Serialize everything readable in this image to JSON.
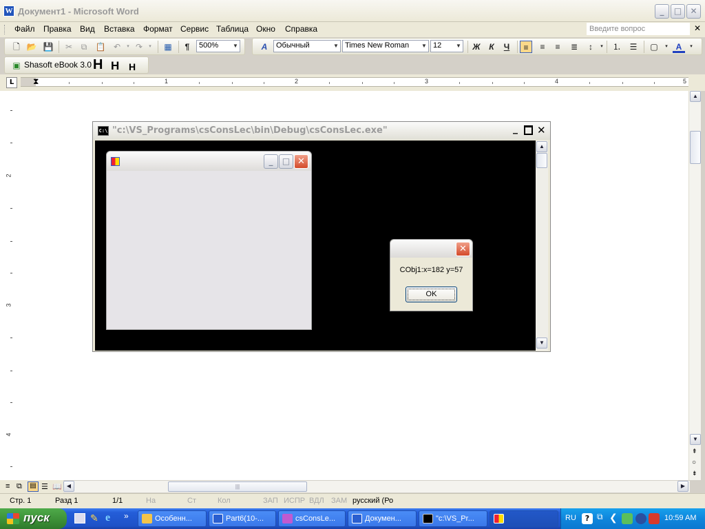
{
  "word": {
    "title": "Документ1 - Microsoft Word",
    "menu": [
      "Файл",
      "Правка",
      "Вид",
      "Вставка",
      "Формат",
      "Сервис",
      "Таблица",
      "Окно",
      "Справка"
    ],
    "ask_placeholder": "Введите вопрос",
    "zoom": "500%",
    "style": "Обычный",
    "font": "Times New Roman",
    "size": "12",
    "bold": "Ж",
    "italic": "К",
    "underline": "Ч",
    "addin": "Shasoft eBook 3.0",
    "heading_buttons": [
      "H",
      "H",
      "H"
    ],
    "ruler_numbers": [
      "1",
      "2",
      "3",
      "4",
      "5"
    ],
    "vruler_numbers": [
      "2",
      "3",
      "4"
    ]
  },
  "console": {
    "title": "\"c:\\VS_Programs\\csConsLec\\bin\\Debug\\csConsLec.exe\""
  },
  "msgbox": {
    "text": "CObj1:x=182 y=57",
    "ok": "OK"
  },
  "status": {
    "page": "Стр. 1",
    "section": "Разд 1",
    "pages": "1/1",
    "at": "На",
    "line": "Ст",
    "col": "Кол",
    "rec": "ЗАП",
    "trk": "ИСПР",
    "ext": "ВДЛ",
    "ovr": "ЗАМ",
    "lang": "русский (Ро"
  },
  "taskbar": {
    "start": "пуск",
    "tasks": [
      "Особенн...",
      "Part6(10-...",
      "csConsLe...",
      "Докумен...",
      "\"c:\\VS_Pr..."
    ],
    "lang": "RU",
    "time": "10:59 AM"
  }
}
